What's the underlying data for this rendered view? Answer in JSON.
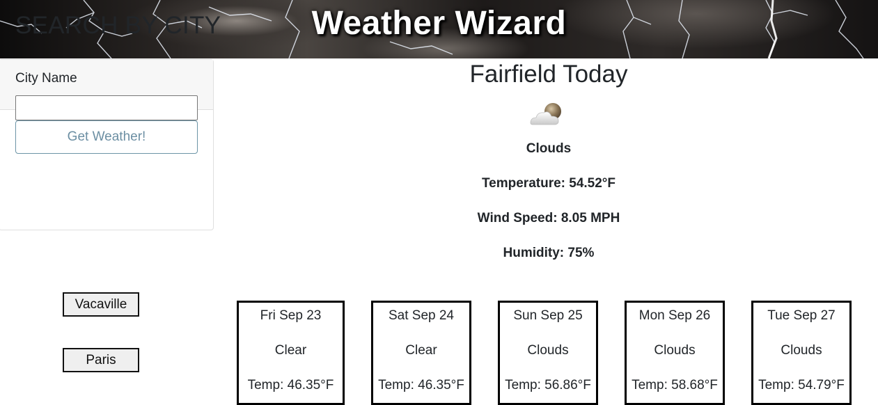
{
  "header": {
    "title": "Weather Wizard"
  },
  "search": {
    "title": "SEARCH BY CITY",
    "city_label": "City Name",
    "input_value": "",
    "button_label": "Get Weather!"
  },
  "history": [
    "Vacaville",
    "Paris"
  ],
  "today": {
    "title": "Fairfield Today",
    "icon": "cloud-moon-icon",
    "description": "Clouds",
    "temperature": "Temperature: 54.52°F",
    "wind": "Wind Speed: 8.05 MPH",
    "humidity": "Humidity: 75%"
  },
  "forecast": [
    {
      "date": "Fri Sep 23",
      "desc": "Clear",
      "temp": "Temp: 46.35°F"
    },
    {
      "date": "Sat Sep 24",
      "desc": "Clear",
      "temp": "Temp: 46.35°F"
    },
    {
      "date": "Sun Sep 25",
      "desc": "Clouds",
      "temp": "Temp: 56.86°F"
    },
    {
      "date": "Mon Sep 26",
      "desc": "Clouds",
      "temp": "Temp: 58.68°F"
    },
    {
      "date": "Tue Sep 27",
      "desc": "Clouds",
      "temp": "Temp: 54.79°F"
    }
  ],
  "colors": {
    "button_border": "#6c94a6",
    "card_header_bg": "#f7f7f7",
    "history_bg": "#efefef"
  }
}
